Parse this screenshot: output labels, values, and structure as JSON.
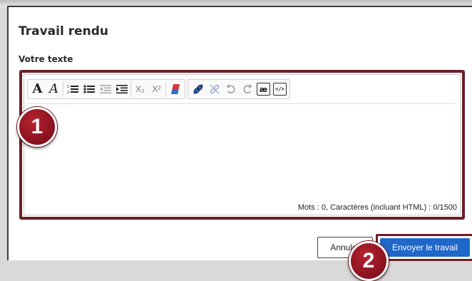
{
  "dialog": {
    "title": "Travail rendu",
    "field_label": "Votre texte"
  },
  "editor": {
    "toolbar": [
      {
        "name": "bold-icon",
        "glyph": "A"
      },
      {
        "name": "italic-icon",
        "glyph": "A"
      },
      {
        "name": "ordered-list-icon"
      },
      {
        "name": "bulleted-list-icon"
      },
      {
        "name": "outdent-icon"
      },
      {
        "name": "indent-icon"
      },
      {
        "name": "subscript-icon",
        "glyph": "X₂"
      },
      {
        "name": "superscript-icon",
        "glyph": "X²"
      },
      {
        "name": "eraser-icon"
      },
      {
        "name": "link-icon"
      },
      {
        "name": "unlink-icon"
      },
      {
        "name": "undo-icon"
      },
      {
        "name": "redo-icon"
      },
      {
        "name": "special-chars-icon",
        "glyph": "æ"
      },
      {
        "name": "source-code-icon",
        "glyph": "</>"
      }
    ],
    "counter": "Mots : 0, Caractères (incluant HTML) : 0/1500"
  },
  "buttons": {
    "cancel": "Annuler",
    "submit": "Envoyer le travail"
  },
  "callouts": {
    "first": "1",
    "second": "2"
  },
  "colors": {
    "accent_frame": "#6b1f28",
    "callout_red": "#9c1724",
    "primary_button": "#1f67c9"
  }
}
